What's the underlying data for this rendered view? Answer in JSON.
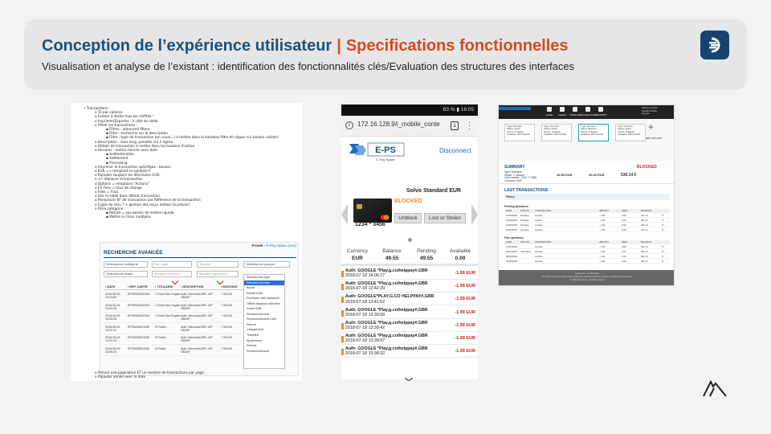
{
  "header": {
    "title_main": "Conception de l’expérience utilisateur",
    "separator": "|",
    "title_accent": "Specifications fonctionnelles",
    "subtitle": "Visualisation et analyse de l’existant : identification des fonctionnalités clés/Evaluation des structures des interfaces"
  },
  "colors": {
    "navy": "#1e4f78",
    "accent": "#d84a1b",
    "header_bg": "#e6e6e8"
  },
  "doc": {
    "lines": [
      {
        "lvl": 1,
        "text": "Transactions :"
      },
      {
        "lvl": 2,
        "text": "Tri par colonne"
      },
      {
        "lvl": 2,
        "text": "Fermer à droite tous les chiffres !"
      },
      {
        "lvl": 2,
        "text": "Imprimer/Exporter : à côté de solde"
      },
      {
        "lvl": 2,
        "text": "Filtrer les transactions :"
      },
      {
        "lvl": 3,
        "text": "Filtres : advanced filters"
      },
      {
        "lvl": 3,
        "text": "Filtre : recherche sur la description"
      },
      {
        "lvl": 3,
        "text": "Filtre : type de transaction (en cours...) à mettre dans le bandeau filtre et cliquer sur bouton valider/"
      },
      {
        "lvl": 2,
        "text": ""
      },
      {
        "lvl": 2,
        "text": "Description : sans long, possible sur 2 lignes"
      },
      {
        "lvl": 2,
        "text": "Détails de transaction à mettre dans les boutons d'action"
      },
      {
        "lvl": 2,
        "text": "Horaires : mettre horaire avec date"
      },
      {
        "lvl": 3,
        "text": "Authentication"
      },
      {
        "lvl": 3,
        "text": "Settlement"
      },
      {
        "lvl": 3,
        "text": "Processing"
      },
      {
        "lvl": 2,
        "text": ""
      },
      {
        "lvl": 2,
        "text": "Imprimer la transaction spécifique : bouton"
      },
      {
        "lvl": 2,
        "text": "EUR => remplacé le symbole €"
      },
      {
        "lvl": 2,
        "text": "Rajouter toujours les décimales 0,00"
      },
      {
        "lvl": 2,
        "text": "+/- déplacer la transaction"
      },
      {
        "lvl": 2,
        "text": "Options = remplacer \"Actions\""
      },
      {
        "lvl": 2,
        "text": "FX Fees = taux de change"
      },
      {
        "lvl": 2,
        "text": "Fees = Frais"
      },
      {
        "lvl": 2,
        "text": "Voir le solde dans détails transaction"
      },
      {
        "lvl": 2,
        "text": "Remplacer N° de transaction par Référence de la transaction"
      },
      {
        "lvl": 2,
        "text": "Copie du reçu ? + gestion des reçus doliber (à prévoir)"
      },
      {
        "lvl": 2,
        "text": "Filtre catégorie :"
      },
      {
        "lvl": 3,
        "text": "Retrait = pas besoin de mettre liquide"
      },
      {
        "lvl": 3,
        "text": "Mettre le choix multiples"
      }
    ],
    "bottom_lines": [
      "Prévoir une pagination ET un nombre de transactions par page.",
      "Rajouter année avec la date"
    ],
    "search": {
      "credit_prefix": "Fronté - ",
      "credit_link": "E-Pay Space (ncs)",
      "title": "RECHERCHE AVANCÉE",
      "row1": [
        "Sélectionner catégorie",
        "Ref. carte",
        "Titulaire",
        "Sélectionner groupe"
      ],
      "row2": [
        "Sélectionner statut",
        "Montant inférieur à",
        "Montant supérieur à"
      ],
      "dropdown": [
        "Sélectionner type",
        "Sélectionner type",
        "Achat",
        "Retrait DAB",
        "Purchase with cashback",
        "Offline balance collection",
        "Solde DAB",
        "Remboursement",
        "Remboursement DAB",
        "Interne",
        "Chargement",
        "Transfert",
        "Ajustement",
        "Refund",
        "Remboursement"
      ],
      "columns": [
        "DATE",
        "REF. CARTE",
        "TITULAIRE",
        "DESCRIPTION",
        "MONTANT"
      ],
      "rows": [
        [
          "2018-05-25 15:03:52",
          "EPS9546343194",
          "C.Ersel Des Sogels",
          "Auth: Merchant,BR1 10P GB25P",
          "7 000,00"
        ],
        [
          "2018-05-25 15:03:35",
          "EPS9546343194",
          "C.Ersel Des Sogels",
          "Auth: Merchant,BR1 10P GB25P",
          "7 000,00"
        ],
        [
          "2018-05-25 15:59:06",
          "EPS9546343194",
          "C.Ersel Des Sogels",
          "Auth: Merchant,BR1 10P GB25P",
          "7 000,00"
        ],
        [
          "2018-05-09 15:22:19",
          "EPS2818201256",
          "S.Portier",
          "Auth: Merchant,BR1 10P GB25P",
          "7 000,00"
        ],
        [
          "2018-05-09 14:21:34",
          "EPS2818201256",
          "S.Portier",
          "Auth: Merchant,BR1 10P GB25P",
          "7 000,00"
        ],
        [
          "2018-05-09 13:59:20",
          "EPS2818201256",
          "S.Portier",
          "Auth: Merchant,BR1 10P GB25P",
          "7 000,00"
        ]
      ]
    }
  },
  "mobile": {
    "status": "83 % ▮ 16:05",
    "url": "172.16.128.9/i_mobile_conte",
    "tab_count": "1",
    "logo_text": "E-PS",
    "logo_sub": "E-Pay Space",
    "disconnect": "Disconnect",
    "card_title": "Solvo Standard EUR",
    "blocked": "BLOCKED",
    "card_number": "1234 * 3456",
    "unblock": "Unblock",
    "lost": "Lost or Stolen",
    "balance_headers": [
      "Currency",
      "Balance",
      "Pending",
      "Available"
    ],
    "balance_values": [
      "EUR",
      "49.55",
      "49.55",
      "0.00"
    ],
    "transactions": [
      {
        "desc": "Auth: GOOGLE *Play,g.co/helppay#,GBR",
        "date": "2018-07-18 14:06:27",
        "amount": "-1.99 EUR"
      },
      {
        "desc": "Auth: GOOGLE *Play,g.co/helppay#,GBR",
        "date": "2018-07-18 13:42:20",
        "amount": "-1.99 EUR"
      },
      {
        "desc": "Auth: GOOGLE*PLAY,G.CO HELPPAY#,GBR",
        "date": "2018-07-18 13:41:52",
        "amount": "-1.99 EUR"
      },
      {
        "desc": "Auth: GOOGLE *Play,g.co/helppay#,GBR",
        "date": "2018-07-18 13:39:58",
        "amount": "-1.99 EUR"
      },
      {
        "desc": "Auth: GOOGLE *Play,g.co/helppay#,GBR",
        "date": "2018-07-18 13:39:42",
        "amount": "-1.99 EUR"
      },
      {
        "desc": "Auth: GOOGLE *Play,g.co/helppay#,GBR",
        "date": "2018-07-18 13:39:07",
        "amount": "-1.99 EUR"
      },
      {
        "desc": "Auth: GOOGLE *Play,g.co/helppay#,GBR",
        "date": "2018-07-18 13:38:32",
        "amount": "-1.99 EUR"
      }
    ]
  },
  "web": {
    "nav": [
      "HOME",
      "CARDS",
      "PROFILE",
      "TRANSACTION",
      "SUPPORT"
    ],
    "user": [
      "Welcome back",
      "Sylvain Portier",
      "Log out"
    ],
    "cards": [
      [
        "Type: Prémium",
        "Status: Active",
        "Owner: N.Saada",
        "Available: 530.14 EUR"
      ],
      [
        "Type: Prémium",
        "Status: Active",
        "Owner: N.Saada",
        "Available: 530.14 EUR"
      ],
      [
        "Type: Prémium",
        "Status: Blocked",
        "Owner: N.Saada",
        "Available: 530.14 EUR"
      ],
      [
        "Type: Prémium",
        "Status: Active",
        "Owner: N.Saada",
        "Available: 530.14 EUR"
      ]
    ],
    "add_card": "activate new card",
    "summary": "SUMMARY",
    "summary_status": "BLOCKED",
    "summary_info": [
      "Type: Business",
      "Owner: V. Bonner",
      "Card number: 1234 *** 3456",
      "Currency: EUR"
    ],
    "summary_nums": [
      "49.55 EUR",
      "65.30 EUR",
      "530.14 €"
    ],
    "last_tx": "LAST TRANSACTIONS",
    "filters": "Filters",
    "pending": "Pending operations",
    "past": "Past operations",
    "th": [
      "DATE",
      "STATUS",
      "TRANSACTION",
      "AMOUNT",
      "FEES",
      "BALANCE"
    ],
    "pending_rows": [
      [
        "15/06/2018",
        "Pending",
        "Auchan",
        "- 1.99",
        "0.00",
        "491.14"
      ],
      [
        "12/06/2018",
        "Pending",
        "Auchan",
        "- 1.99",
        "0.00",
        "491.14"
      ],
      [
        "12/06/2018",
        "Pending",
        "Auchan",
        "- 1.99",
        "0.00",
        "491.14"
      ],
      [
        "11/06/2018",
        "Pending",
        "Auchan",
        "- 1.99",
        "0.00",
        "491.14"
      ]
    ],
    "past_rows": [
      [
        "10/06/2018",
        "",
        "Auchan",
        "- 1.99",
        "0.00",
        "491.14"
      ],
      [
        "09/06/2018",
        "Cancelled",
        "Auchan",
        "- 1.99",
        "0.00",
        "491.14"
      ],
      [
        "08/06/2018",
        "",
        "Auchan",
        "- 1.99",
        "0.00",
        "491.14"
      ],
      [
        "07/06/2018",
        "",
        "Auchan",
        "- 1.99",
        "0.00",
        "491.14"
      ]
    ],
    "footer": [
      "Legal notice - Confidentiality",
      "This card is issued by Prepaid Financial Services Limited pursuant to a license by Mastercard International.",
      "© 2018 E-Pay Space - All rights reserved"
    ]
  }
}
